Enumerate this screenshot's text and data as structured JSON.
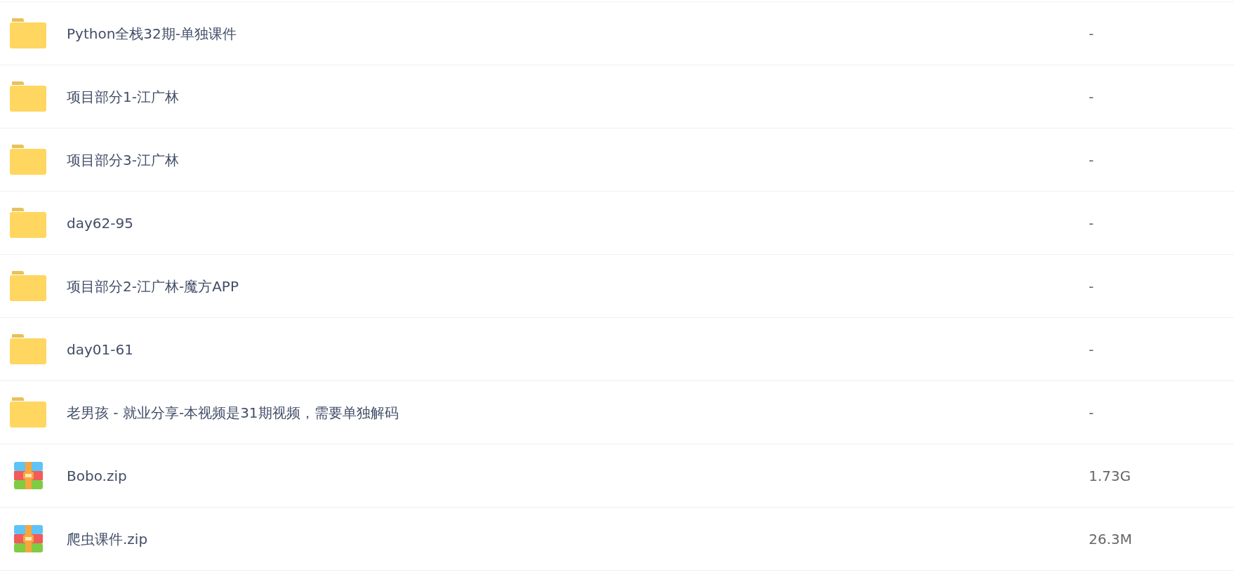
{
  "files": [
    {
      "kind": "folder",
      "name": "Python全栈32期-单独课件",
      "size": "-"
    },
    {
      "kind": "folder",
      "name": "项目部分1-江广林",
      "size": "-"
    },
    {
      "kind": "folder",
      "name": "项目部分3-江广林",
      "size": "-"
    },
    {
      "kind": "folder",
      "name": "day62-95",
      "size": "-"
    },
    {
      "kind": "folder",
      "name": "项目部分2-江广林-魔方APP",
      "size": "-"
    },
    {
      "kind": "folder",
      "name": "day01-61",
      "size": "-"
    },
    {
      "kind": "folder",
      "name": "老男孩 - 就业分享-本视频是31期视频，需要单独解码",
      "size": "-"
    },
    {
      "kind": "zip",
      "name": "Bobo.zip",
      "size": "1.73G"
    },
    {
      "kind": "zip",
      "name": "爬虫课件.zip",
      "size": "26.3M"
    }
  ]
}
